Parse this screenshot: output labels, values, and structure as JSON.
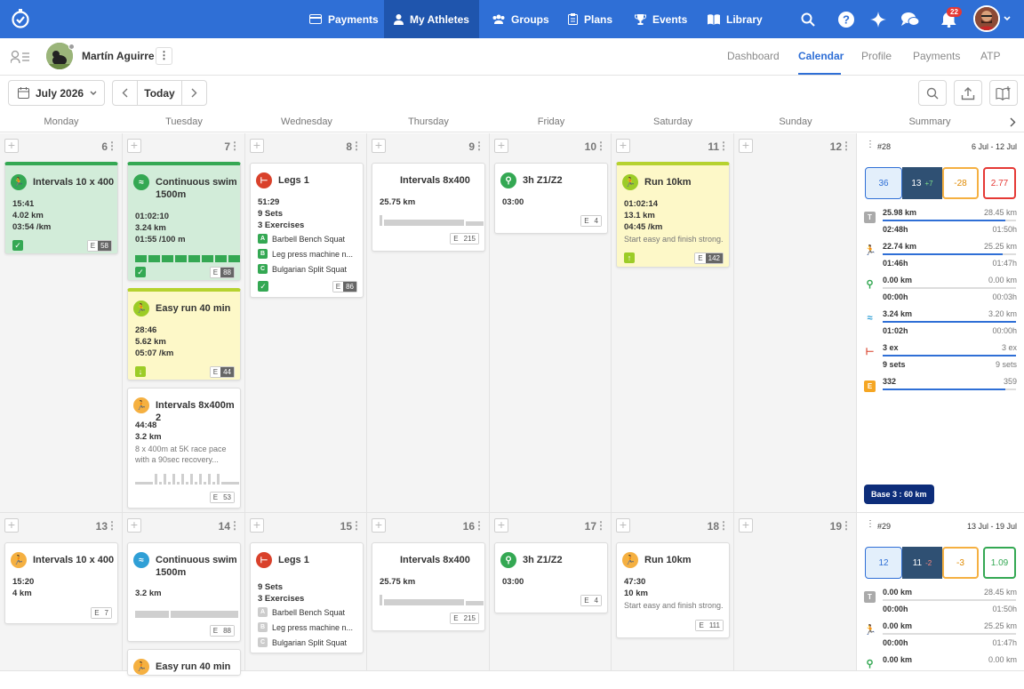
{
  "nav": {
    "items": [
      "Payments",
      "My Athletes",
      "Groups",
      "Plans",
      "Events",
      "Library"
    ],
    "bell_count": "22"
  },
  "athlete": {
    "name": "Martín Aguirre"
  },
  "tabs": [
    "Dashboard",
    "Calendar",
    "Profile",
    "Payments",
    "ATP"
  ],
  "toolbar": {
    "month": "July 2026",
    "today": "Today"
  },
  "days": [
    "Monday",
    "Tuesday",
    "Wednesday",
    "Thursday",
    "Friday",
    "Saturday",
    "Sunday",
    "Summary"
  ],
  "week1": {
    "dates": [
      "6",
      "7",
      "8",
      "9",
      "10",
      "11",
      "12"
    ],
    "summary": {
      "num": "#28",
      "range": "6 Jul - 12 Jul",
      "box1": "36",
      "box2": "13",
      "box2b": "+7",
      "box3": "-28",
      "box4": "2.77",
      "rows": [
        {
          "a": "25.98 km",
          "b": "28.45 km",
          "c": "02:48h",
          "d": "01:50h"
        },
        {
          "a": "22.74 km",
          "b": "25.25 km",
          "c": "01:46h",
          "d": "01:47h"
        },
        {
          "a": "0.00 km",
          "b": "0.00 km",
          "c": "00:00h",
          "d": "00:03h"
        },
        {
          "a": "3.24 km",
          "b": "3.20 km",
          "c": "01:02h",
          "d": "00:00h"
        },
        {
          "a": "3 ex",
          "b": "3 ex",
          "c": "9 sets",
          "d": "9 sets"
        },
        {
          "a": "332",
          "b": "359",
          "c": "",
          "d": ""
        }
      ],
      "phase": "Base 3 : 60 km"
    }
  },
  "week2": {
    "dates": [
      "13",
      "14",
      "15",
      "16",
      "17",
      "18",
      "19"
    ],
    "summary": {
      "num": "#29",
      "range": "13 Jul - 19 Jul",
      "box1": "12",
      "box2": "11",
      "box2b": "-2",
      "box3": "-3",
      "box4": "1.09",
      "rows": [
        {
          "a": "0.00 km",
          "b": "28.45 km",
          "c": "00:00h",
          "d": "01:50h"
        },
        {
          "a": "0.00 km",
          "b": "25.25 km",
          "c": "00:00h",
          "d": "01:47h"
        },
        {
          "a": "0.00 km",
          "b": "0.00 km",
          "c": "",
          "d": ""
        }
      ]
    }
  },
  "cards": {
    "mon1": {
      "title": "Intervals 10 x 400",
      "l1": "15:41",
      "l2": "4.02 km",
      "l3": "03:54 /km",
      "e": "E",
      "v": "58"
    },
    "tue1": {
      "title": "Continuous swim 1500m",
      "l1": "01:02:10",
      "l2": "3.24 km",
      "l3": "01:55 /100 m",
      "e": "E",
      "v": "88"
    },
    "tue2": {
      "title": "Easy run 40 min",
      "l1": "28:46",
      "l2": "5.62 km",
      "l3": "05:07 /km",
      "e": "E",
      "v": "44"
    },
    "tue3": {
      "title": "Intervals 8x400m 2",
      "l1": "44:48",
      "l2": "3.2 km",
      "desc": "8 x 400m at 5K race pace with a 90sec recovery...",
      "e": "E",
      "v": "53"
    },
    "wed1": {
      "title": "Legs 1",
      "l1": "51:29",
      "l2": "9 Sets",
      "l3": "3 Exercises",
      "ex": [
        "Barbell Bench Squat",
        "Leg press machine n...",
        "Bulgarian Split Squat"
      ],
      "exk": [
        "A",
        "B",
        "C"
      ],
      "e": "E",
      "v": "86"
    },
    "thu1": {
      "title": "Intervals 8x400",
      "l1": "25.75 km",
      "e": "E",
      "v": "215"
    },
    "fri1": {
      "title": "3h Z1/Z2",
      "l1": "03:00",
      "e": "E",
      "v": "4"
    },
    "sat1": {
      "title": "Run 10km",
      "l1": "01:02:14",
      "l2": "13.1 km",
      "l3": "04:45 /km",
      "desc": "Start easy and finish strong.",
      "e": "E",
      "v": "142"
    },
    "mon2": {
      "title": "Intervals 10 x 400",
      "l1": "15:20",
      "l2": "4 km",
      "e": "E",
      "v": "7"
    },
    "tue4": {
      "title": "Continuous swim 1500m",
      "l1": "3.2 km",
      "e": "E",
      "v": "88"
    },
    "tue5": {
      "title": "Easy run 40 min"
    },
    "wed2": {
      "title": "Legs 1",
      "l1": "9 Sets",
      "l2": "3 Exercises",
      "ex": [
        "Barbell Bench Squat",
        "Leg press machine n...",
        "Bulgarian Split Squat"
      ],
      "exk": [
        "A",
        "B",
        "C"
      ]
    },
    "thu2": {
      "title": "Intervals 8x400",
      "l1": "25.75 km",
      "e": "E",
      "v": "215"
    },
    "fri2": {
      "title": "3h Z1/Z2",
      "l1": "03:00",
      "e": "E",
      "v": "4"
    },
    "sat2": {
      "title": "Run 10km",
      "l1": "47:30",
      "l2": "10 km",
      "desc": "Start easy and finish strong.",
      "e": "E",
      "v": "111"
    }
  },
  "colors": {
    "primary": "#2f6fd6",
    "completed": "#d2ecd9",
    "partial": "#fdf8c8"
  }
}
